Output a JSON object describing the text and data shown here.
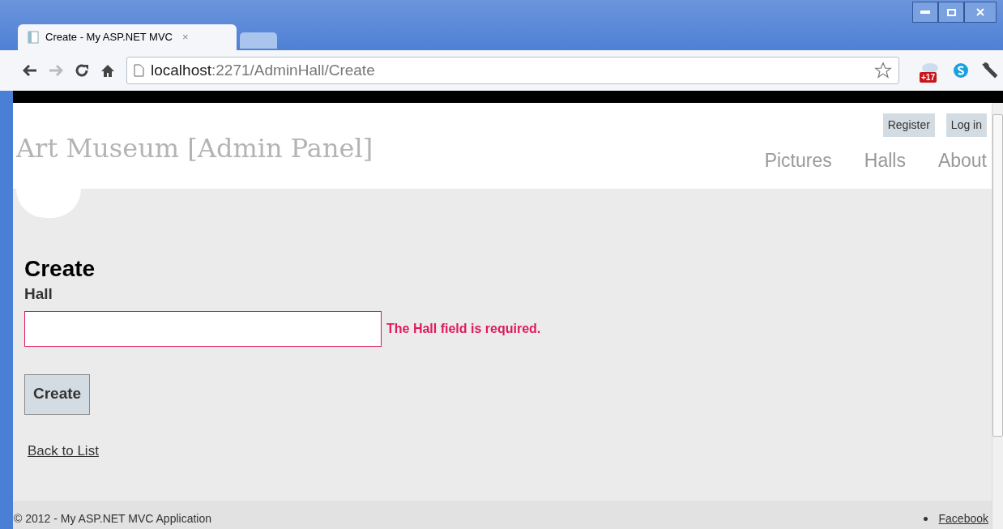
{
  "browser": {
    "tabs": [
      {
        "title": "Create - My ASP.NET MVC",
        "selected": true
      }
    ],
    "close_tab": "×",
    "address": {
      "host": "localhost",
      "path": ":2271/AdminHall/Create"
    },
    "extension_badge": "+17"
  },
  "site": {
    "title": "Art Museum [Admin Panel]",
    "account_links": [
      "Register",
      "Log in"
    ],
    "nav": [
      "Pictures",
      "Halls",
      "About"
    ]
  },
  "form": {
    "heading": "Create",
    "label": "Hall",
    "error": "The Hall field is required.",
    "invalid": true,
    "submit": "Create",
    "back_link": "Back to List"
  },
  "footer": {
    "copyright": "© 2012 - My ASP.NET MVC Application",
    "links": [
      "Facebook"
    ]
  }
}
